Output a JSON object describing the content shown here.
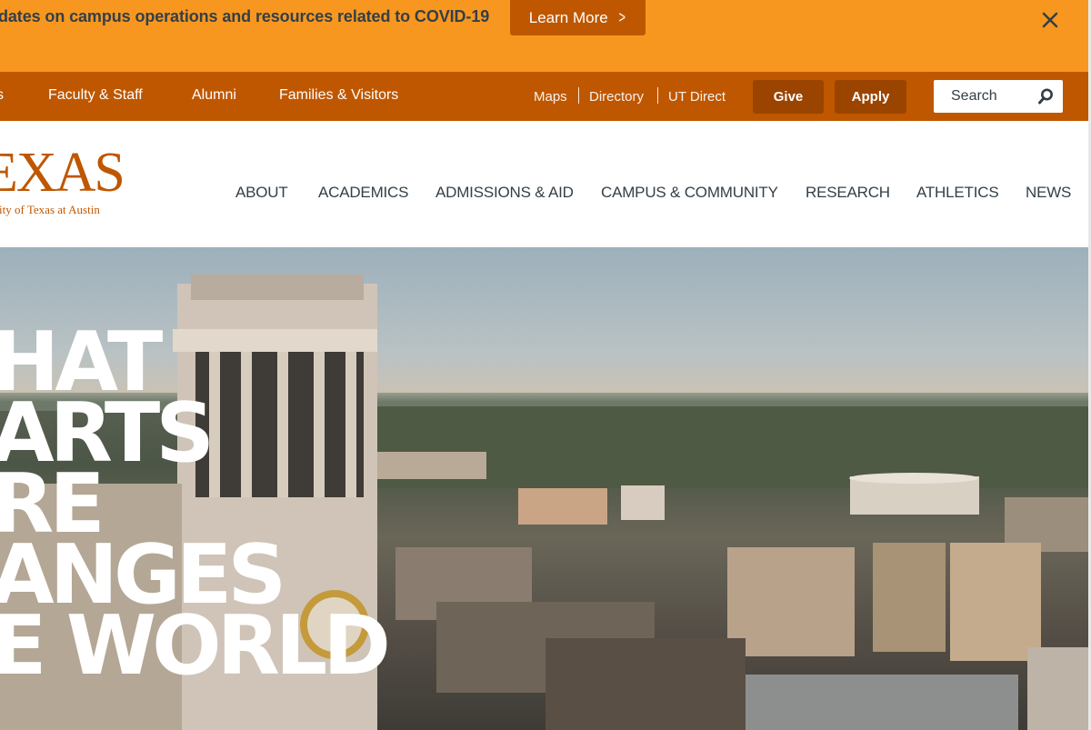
{
  "alert": {
    "message": "dates on campus operations and resources related to COVID-19",
    "learn_more_label": "Learn More",
    "close_icon": "close-icon"
  },
  "utility_nav": {
    "audience_links": [
      "s",
      "Faculty & Staff",
      "Alumni",
      "Families & Visitors"
    ],
    "quick_links": [
      "Maps",
      "Directory",
      "UT Direct"
    ],
    "give_label": "Give",
    "apply_label": "Apply",
    "search_label": "Search",
    "search_icon": "search-icon"
  },
  "branding": {
    "wordmark": "EXAS",
    "subtitle": "sity of Texas at Austin"
  },
  "main_nav": {
    "items": [
      "ABOUT",
      "ACADEMICS",
      "ADMISSIONS & AID",
      "CAMPUS & COMMUNITY",
      "RESEARCH",
      "ATHLETICS",
      "NEWS"
    ]
  },
  "hero": {
    "lines": [
      "HAT",
      "ARTS",
      "RE",
      "ANGES",
      "E WORLD"
    ]
  },
  "colors": {
    "alert_bg": "#f8971f",
    "burnt_orange": "#bf5700",
    "button_dark": "#9b4400",
    "text_dark": "#333f48"
  }
}
